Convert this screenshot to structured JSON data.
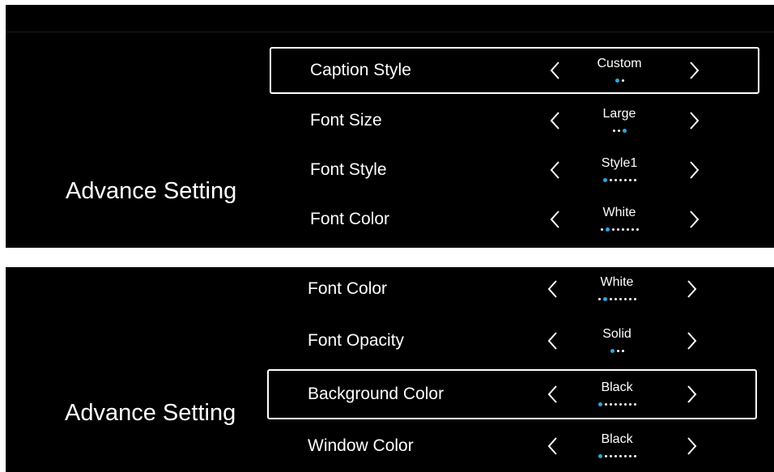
{
  "colors": {
    "background": "#000000",
    "text": "#ffffff",
    "selected_border": "#ffffff",
    "active_dot": "#2ea7e0"
  },
  "top_panel": {
    "section_title": "Advance Setting",
    "rows": [
      {
        "label": "Caption Style",
        "value": "Custom",
        "dot_count": 2,
        "active_dot": 1,
        "selected": true
      },
      {
        "label": "Font Size",
        "value": "Large",
        "dot_count": 3,
        "active_dot": 3,
        "selected": false
      },
      {
        "label": "Font Style",
        "value": "Style1",
        "dot_count": 7,
        "active_dot": 1,
        "selected": false
      },
      {
        "label": "Font Color",
        "value": "White",
        "dot_count": 8,
        "active_dot": 2,
        "selected": false
      }
    ]
  },
  "bottom_panel": {
    "section_title": "Advance Setting",
    "rows": [
      {
        "label": "Font Color",
        "value": "White",
        "dot_count": 8,
        "active_dot": 2,
        "selected": false
      },
      {
        "label": "Font Opacity",
        "value": "Solid",
        "dot_count": 3,
        "active_dot": 1,
        "selected": false
      },
      {
        "label": "Background Color",
        "value": "Black",
        "dot_count": 8,
        "active_dot": 1,
        "selected": true
      },
      {
        "label": "Window Color",
        "value": "Black",
        "dot_count": 8,
        "active_dot": 1,
        "selected": false
      }
    ]
  },
  "icons": {
    "prev": "chevron-left-icon",
    "next": "chevron-right-icon"
  }
}
